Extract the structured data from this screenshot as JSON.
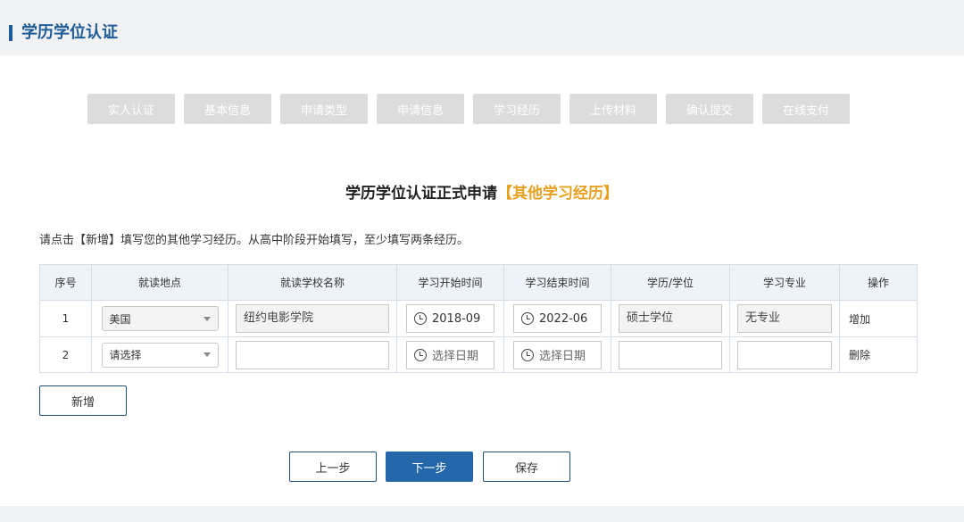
{
  "header": {
    "title": "学历学位认证"
  },
  "steps": [
    "实人认证",
    "基本信息",
    "申请类型",
    "申请信息",
    "学习经历",
    "上传材料",
    "确认提交",
    "在线支付"
  ],
  "form": {
    "title": "学历学位认证正式申请",
    "title_highlight": "【其他学习经历】",
    "hint": "请点击【新增】填写您的其他学习经历。从高中阶段开始填写，至少填写两条经历。"
  },
  "table": {
    "headers": [
      "序号",
      "就读地点",
      "就读学校名称",
      "学习开始时间",
      "学习结束时间",
      "学历/学位",
      "学习专业",
      "操作"
    ],
    "rows": [
      {
        "index": "1",
        "location": "美国",
        "school": "纽约电影学院",
        "start": "2018-09",
        "end": "2022-06",
        "degree": "硕士学位",
        "major": "无专业",
        "action": "增加"
      },
      {
        "index": "2",
        "location": "请选择",
        "school": "",
        "start": "选择日期",
        "end": "选择日期",
        "degree": "",
        "major": "",
        "action": "删除"
      }
    ]
  },
  "buttons": {
    "add": "新增",
    "prev": "上一步",
    "next": "下一步",
    "save": "保存"
  },
  "colors": {
    "accent": "#2468ab",
    "highlight": "#e8a020",
    "header": "#1f5b96"
  }
}
